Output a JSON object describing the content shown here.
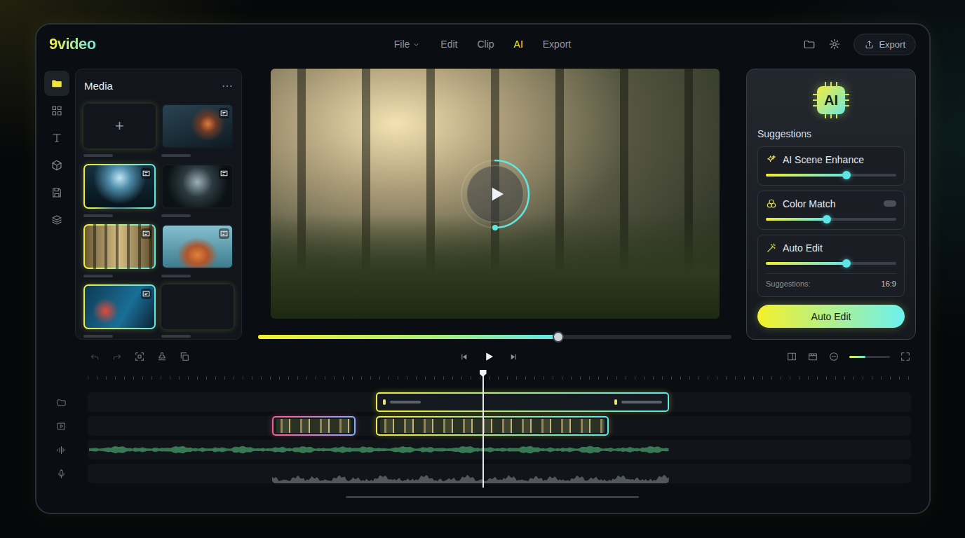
{
  "app": {
    "logo": "9video"
  },
  "menu": [
    {
      "label": "File",
      "selected": false,
      "dropdown": true
    },
    {
      "label": "Edit",
      "selected": false,
      "dropdown": false
    },
    {
      "label": "Clip",
      "selected": false,
      "dropdown": false
    },
    {
      "label": "AI",
      "selected": true,
      "dropdown": false
    },
    {
      "label": "Export",
      "selected": false,
      "dropdown": false
    }
  ],
  "header_actions": {
    "export_button": "Export"
  },
  "sidebar": {
    "items": [
      {
        "selected": true
      },
      {
        "selected": false
      },
      {
        "selected": false
      },
      {
        "selected": false
      },
      {
        "selected": false
      },
      {
        "selected": false
      }
    ]
  },
  "media": {
    "title": "Media",
    "more": "⋯",
    "items": [
      {
        "kind": "add",
        "label": "+",
        "selected": true
      },
      {
        "kind": "video",
        "label": "",
        "selected": false
      },
      {
        "kind": "video",
        "label": "",
        "selected": true
      },
      {
        "kind": "video",
        "label": "",
        "selected": false
      },
      {
        "kind": "video",
        "label": "",
        "selected": true
      },
      {
        "kind": "video",
        "label": "",
        "selected": false
      },
      {
        "kind": "video",
        "label": "",
        "selected": true
      },
      {
        "kind": "audio",
        "label": "",
        "selected": true
      }
    ]
  },
  "player": {
    "ring_level": 0.5,
    "progress": 0.634
  },
  "suggestions": {
    "badge": "AI",
    "title": "Suggestions",
    "items": [
      {
        "kind": "slider",
        "label": "AI Scene Enhance",
        "level": 0.62,
        "on": false,
        "info_label": "",
        "info_value": ""
      },
      {
        "kind": "toggle",
        "label": "Color Match",
        "level": 0.47,
        "on": false,
        "info_label": "",
        "info_value": ""
      },
      {
        "kind": "info",
        "label": "Auto Edit",
        "level": 0.62,
        "on": false,
        "info_label": "Suggestions:",
        "info_value": "16:9"
      }
    ],
    "button": "Auto Edit"
  },
  "tools": [
    {
      "disabled": true
    },
    {
      "disabled": true
    },
    {
      "disabled": false
    },
    {
      "disabled": false
    },
    {
      "disabled": false
    }
  ],
  "transport": {
    "zoom_level": 0.4
  },
  "timeline": {
    "playhead": 0.48,
    "tracks": [
      {
        "kind": "title",
        "clips": [
          {
            "kind": "title",
            "start": 0.35,
            "end": 0.706,
            "color": "#f0ec3c",
            "accent": "#5fe6ea"
          }
        ]
      },
      {
        "kind": "video",
        "clips": [
          {
            "kind": "video",
            "start": 0.224,
            "end": 0.325,
            "color": "#ff5c8d",
            "accent": "#7fb0ff"
          },
          {
            "kind": "video",
            "start": 0.35,
            "end": 0.633,
            "color": "#f0ec3c",
            "accent": "#5fe6ea"
          }
        ]
      },
      {
        "kind": "audio",
        "clips": [
          {
            "kind": "wave",
            "start": 0.002,
            "end": 0.706,
            "color": "#3f8a5e",
            "accent": "#3f8a5e"
          }
        ]
      },
      {
        "kind": "voice",
        "clips": [
          {
            "kind": "wave",
            "start": 0.224,
            "end": 0.706,
            "color": "#5e636b",
            "accent": "#5e636b"
          }
        ]
      }
    ]
  }
}
